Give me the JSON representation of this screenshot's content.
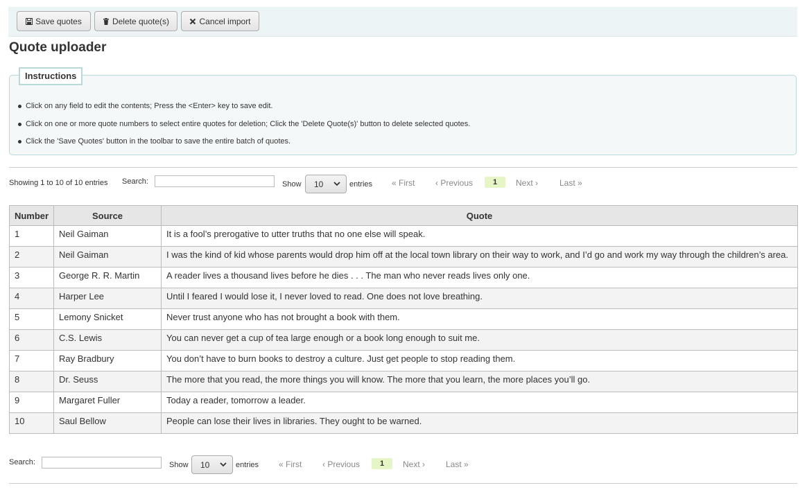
{
  "toolbar": {
    "save_label": "Save quotes",
    "delete_label": "Delete quote(s)",
    "cancel_label": "Cancel import"
  },
  "page_title": "Quote uploader",
  "instructions": {
    "legend": "Instructions",
    "items": [
      "Click on any field to edit the contents; Press the <Enter> key to save edit.",
      "Click on one or more quote numbers to select entire quotes for deletion; Click the 'Delete Quote(s)' button to delete selected quotes.",
      "Click the 'Save Quotes' button in the toolbar to save the entire batch of quotes."
    ]
  },
  "table_info": "Showing 1 to 10 of 10 entries",
  "search": {
    "label": "Search:",
    "value": ""
  },
  "length": {
    "show_label": "Show",
    "value": "10",
    "entries_label": "entries"
  },
  "pagination": {
    "first": "First",
    "previous": "Previous",
    "current": "1",
    "next": "Next",
    "last": "Last"
  },
  "table": {
    "columns": [
      "Number",
      "Source",
      "Quote"
    ],
    "rows": [
      {
        "number": "1",
        "source": "Neil Gaiman",
        "quote": "It is a fool’s prerogative to utter truths that no one else will speak."
      },
      {
        "number": "2",
        "source": "Neil Gaiman",
        "quote": "I was the kind of kid whose parents would drop him off at the local town library on their way to work, and I’d go and work my way through the children’s area."
      },
      {
        "number": "3",
        "source": "George R. R. Martin",
        "quote": "A reader lives a thousand lives before he dies . . . The man who never reads lives only one."
      },
      {
        "number": "4",
        "source": "Harper Lee",
        "quote": "Until I feared I would lose it, I never loved to read. One does not love breathing."
      },
      {
        "number": "5",
        "source": "Lemony Snicket",
        "quote": "Never trust anyone who has not brought a book with them."
      },
      {
        "number": "6",
        "source": "C.S. Lewis",
        "quote": "You can never get a cup of tea large enough or a book long enough to suit me."
      },
      {
        "number": "7",
        "source": "Ray Bradbury",
        "quote": "You don’t have to burn books to destroy a culture. Just get people to stop reading them."
      },
      {
        "number": "8",
        "source": "Dr. Seuss",
        "quote": "The more that you read, the more things you will know. The more that you learn, the more places you’ll go."
      },
      {
        "number": "9",
        "source": "Margaret Fuller",
        "quote": "Today a reader, tomorrow a leader."
      },
      {
        "number": "10",
        "source": "Saul Bellow",
        "quote": "People can lose their lives in libraries. They ought to be warned."
      }
    ]
  },
  "colors": {
    "toolbar_bg": "#edf4f6",
    "instructions_bg": "#f4f8f9",
    "current_page_bg": "#e6f5c5",
    "header_bg": "#e6e6e6"
  }
}
